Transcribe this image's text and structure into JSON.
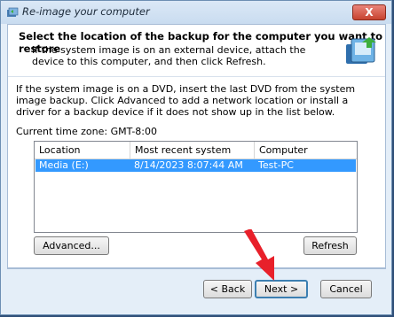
{
  "window": {
    "title": "Re-image your computer",
    "close_label": "X"
  },
  "header": {
    "title": "Select the location of the backup for the computer you want to restore",
    "subtitle": "If the system image is on an external device, attach the device to this computer, and then click Refresh."
  },
  "description": "If the system image is on a DVD, insert the last DVD from the system image backup. Click Advanced to add a network location or install a driver for a backup device if it does not show up in the list below.",
  "time_zone": "Current time zone: GMT-8:00",
  "list": {
    "columns": [
      "Location",
      "Most recent system image",
      "Computer"
    ],
    "rows": [
      {
        "location": "Media (E:)",
        "image": "8/14/2023 8:07:44 AM",
        "computer": "Test-PC",
        "selected": true
      }
    ]
  },
  "buttons": {
    "advanced": "Advanced...",
    "refresh": "Refresh",
    "back": "< Back",
    "next": "Next >",
    "cancel": "Cancel"
  },
  "colors": {
    "selection": "#3399ff",
    "pointer": "#e8202a",
    "close": "#c7432f"
  }
}
